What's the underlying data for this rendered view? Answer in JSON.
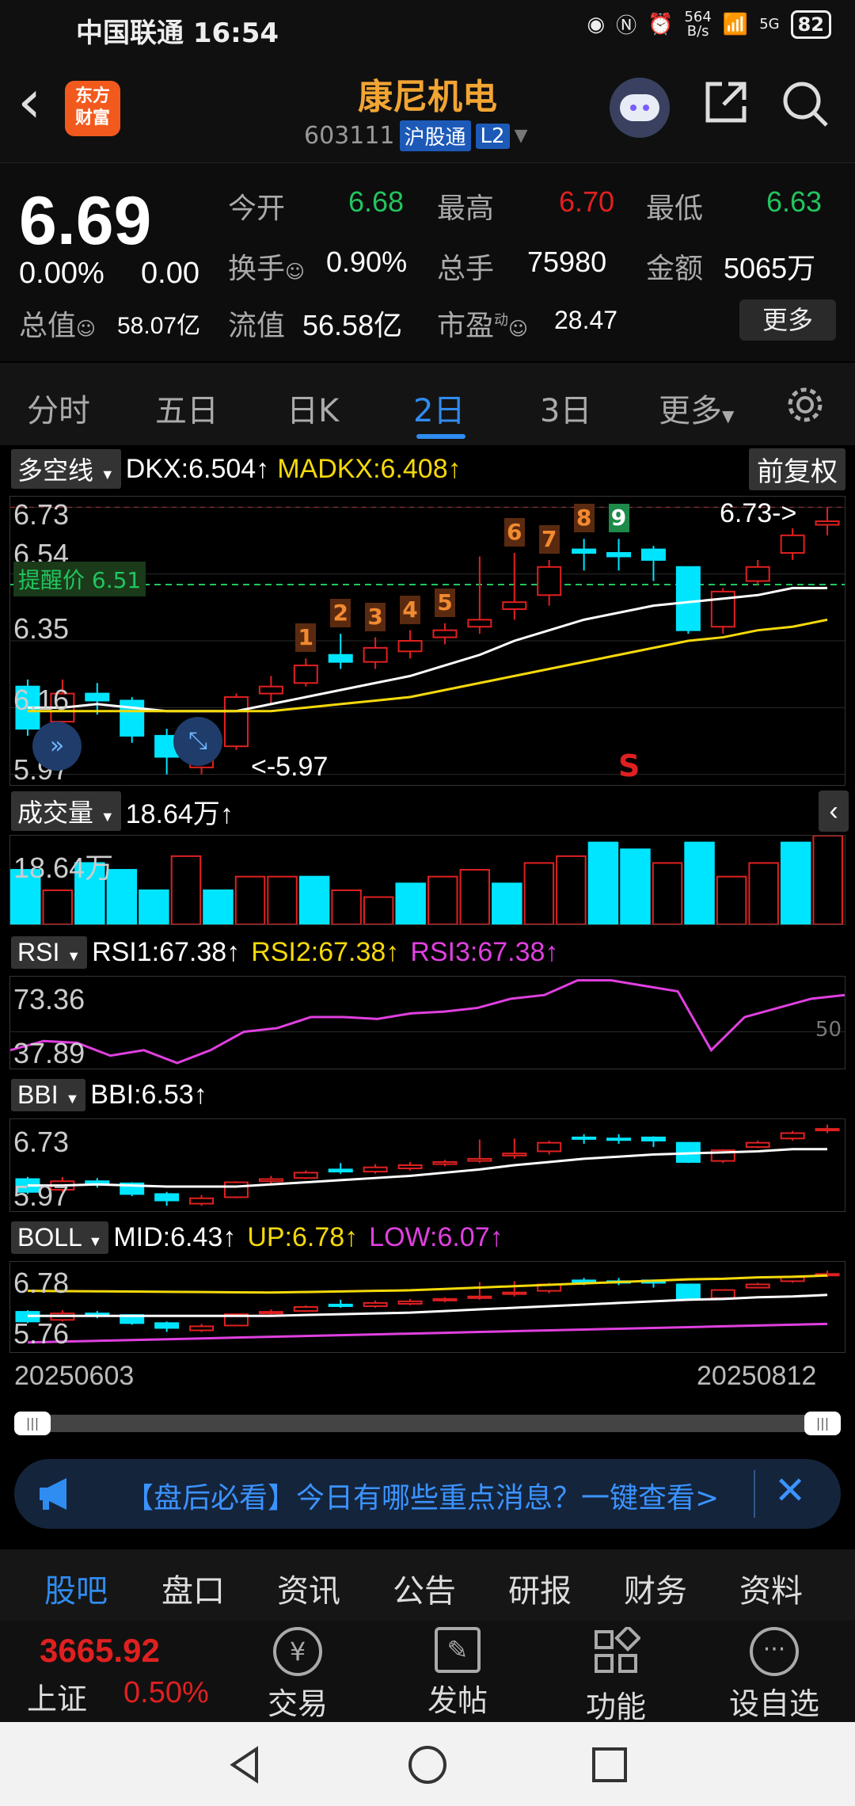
{
  "status": {
    "carrier": "中国联通",
    "time": "16:54",
    "net_speed": "564\nB/s",
    "signal": "5G",
    "battery": "82"
  },
  "header": {
    "back_label": "‹",
    "logo_line1": "东方",
    "logo_line2": "财富",
    "stock_name": "康尼机电",
    "stock_code": "603111",
    "market_tag": "沪股通",
    "level_tag": "L2"
  },
  "quote": {
    "price": "6.69",
    "change_pct": "0.00%",
    "change_amt": "0.00",
    "open_label": "今开",
    "open": "6.68",
    "high_label": "最高",
    "high": "6.70",
    "low_label": "最低",
    "low": "6.63",
    "turnover_label": "换手",
    "turnover": "0.90%",
    "volume_label": "总手",
    "volume": "75980",
    "amount_label": "金额",
    "amount": "5065万",
    "mktcap_label": "总值",
    "mktcap": "58.07亿",
    "float_label": "流值",
    "float_cap": "56.58亿",
    "pe_label": "市盈",
    "pe_sup": "动",
    "pe": "28.47",
    "more": "更多"
  },
  "period_tabs": [
    "分时",
    "五日",
    "日K",
    "2日",
    "3日",
    "更多"
  ],
  "period_active": 3,
  "main_chart": {
    "indicator": "多空线",
    "dkx": "DKX:6.504↑",
    "madkx": "MADKX:6.408↑",
    "adjust": "前复权",
    "y_labels": [
      "6.73",
      "6.54",
      "6.35",
      "6.16",
      "5.97"
    ],
    "alert_label": "提醒价 6.51",
    "high_marker": "6.73->",
    "low_marker": "<-5.97",
    "signal": "S",
    "seq_orange": [
      "1",
      "2",
      "3",
      "4",
      "5",
      "6",
      "7",
      "8"
    ],
    "seq_green": "9"
  },
  "volume": {
    "label": "成交量",
    "value": "18.64万↑",
    "axis": "18.64万"
  },
  "rsi": {
    "label": "RSI",
    "rsi1": "RSI1:67.38↑",
    "rsi2": "RSI2:67.38↑",
    "rsi3": "RSI3:67.38↑",
    "y_top": "73.36",
    "y_bottom": "37.89",
    "y_mid": "50"
  },
  "bbi": {
    "label": "BBI",
    "value": "BBI:6.53↑",
    "y_top": "6.73",
    "y_bottom": "5.97"
  },
  "boll": {
    "label": "BOLL",
    "mid": "MID:6.43↑",
    "up": "UP:6.78↑",
    "low": "LOW:6.07↑",
    "y_top": "6.78",
    "y_bottom": "5.76"
  },
  "dates": {
    "start": "20250603",
    "end": "20250812"
  },
  "banner": {
    "text": "【盘后必看】今日有哪些重点消息？一键查看>"
  },
  "info_tabs": [
    "股吧",
    "盘口",
    "资讯",
    "公告",
    "研报",
    "财务",
    "资料"
  ],
  "info_active": 0,
  "bottom": {
    "index_value": "3665.92",
    "index_name": "上证",
    "index_pct": "0.50%",
    "trade": "交易",
    "post": "发帖",
    "function": "功能",
    "watch": "设自选"
  },
  "colors": {
    "up": "#e02020",
    "down": "#00e5ff",
    "green": "#22c55e",
    "accent": "#2f8cf0",
    "orange": "#f2a533"
  },
  "candles": [
    {
      "o": 6.22,
      "c": 6.1,
      "h": 6.24,
      "l": 6.08
    },
    {
      "o": 6.12,
      "c": 6.2,
      "h": 6.24,
      "l": 6.1
    },
    {
      "o": 6.2,
      "c": 6.18,
      "h": 6.23,
      "l": 6.14
    },
    {
      "o": 6.18,
      "c": 6.08,
      "h": 6.19,
      "l": 6.06
    },
    {
      "o": 6.08,
      "c": 6.02,
      "h": 6.1,
      "l": 5.97
    },
    {
      "o": 5.99,
      "c": 6.04,
      "h": 6.07,
      "l": 5.97
    },
    {
      "o": 6.05,
      "c": 6.19,
      "h": 6.2,
      "l": 6.04
    },
    {
      "o": 6.2,
      "c": 6.22,
      "h": 6.25,
      "l": 6.17
    },
    {
      "o": 6.23,
      "c": 6.28,
      "h": 6.3,
      "l": 6.22
    },
    {
      "o": 6.31,
      "c": 6.29,
      "h": 6.37,
      "l": 6.27
    },
    {
      "o": 6.29,
      "c": 6.33,
      "h": 6.36,
      "l": 6.27
    },
    {
      "o": 6.32,
      "c": 6.35,
      "h": 6.38,
      "l": 6.3
    },
    {
      "o": 6.36,
      "c": 6.38,
      "h": 6.4,
      "l": 6.34
    },
    {
      "o": 6.39,
      "c": 6.41,
      "h": 6.59,
      "l": 6.37
    },
    {
      "o": 6.44,
      "c": 6.46,
      "h": 6.6,
      "l": 6.41
    },
    {
      "o": 6.48,
      "c": 6.56,
      "h": 6.58,
      "l": 6.45
    },
    {
      "o": 6.61,
      "c": 6.6,
      "h": 6.64,
      "l": 6.55
    },
    {
      "o": 6.6,
      "c": 6.59,
      "h": 6.64,
      "l": 6.55
    },
    {
      "o": 6.61,
      "c": 6.58,
      "h": 6.62,
      "l": 6.52
    },
    {
      "o": 6.56,
      "c": 6.38,
      "h": 6.56,
      "l": 6.37
    },
    {
      "o": 6.39,
      "c": 6.49,
      "h": 6.5,
      "l": 6.37
    },
    {
      "o": 6.52,
      "c": 6.56,
      "h": 6.58,
      "l": 6.51
    },
    {
      "o": 6.6,
      "c": 6.65,
      "h": 6.67,
      "l": 6.58
    },
    {
      "o": 6.68,
      "c": 6.69,
      "h": 6.73,
      "l": 6.65
    }
  ],
  "volumes": [
    8,
    5,
    9,
    8,
    5,
    10,
    5,
    7,
    7,
    7,
    5,
    4,
    6,
    7,
    8,
    6,
    9,
    10,
    12,
    11,
    9,
    12,
    7,
    9,
    12,
    13
  ],
  "rsi_series": [
    40,
    45,
    44,
    37,
    40,
    33,
    40,
    50,
    52,
    58,
    58,
    57,
    60,
    61,
    63,
    68,
    70,
    78,
    78,
    75,
    72,
    40,
    58,
    63,
    68,
    70
  ],
  "dkx_series": [
    6.16,
    6.16,
    6.17,
    6.16,
    6.15,
    6.15,
    6.15,
    6.17,
    6.19,
    6.21,
    6.23,
    6.25,
    6.28,
    6.31,
    6.35,
    6.38,
    6.41,
    6.43,
    6.45,
    6.46,
    6.47,
    6.48,
    6.5,
    6.5
  ],
  "madkx_series": [
    6.15,
    6.15,
    6.15,
    6.15,
    6.15,
    6.15,
    6.15,
    6.15,
    6.16,
    6.17,
    6.18,
    6.19,
    6.21,
    6.23,
    6.25,
    6.27,
    6.29,
    6.31,
    6.33,
    6.35,
    6.36,
    6.38,
    6.39,
    6.41
  ]
}
